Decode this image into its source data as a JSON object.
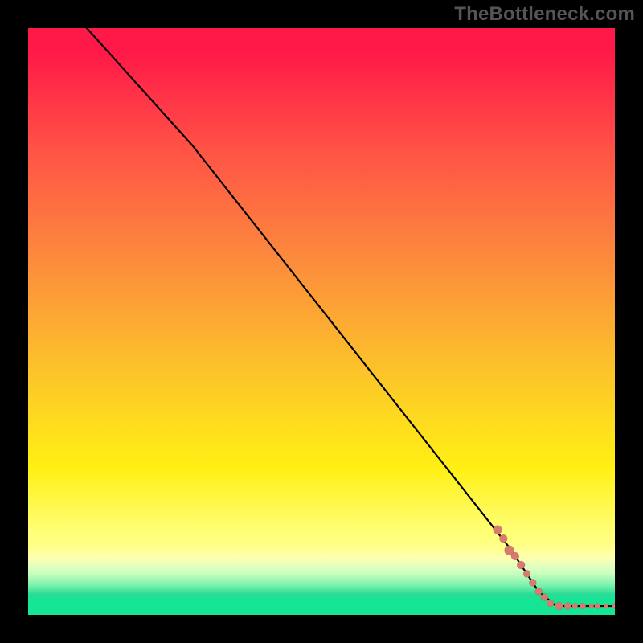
{
  "watermark": "TheBottleneck.com",
  "colors": {
    "frame": "#000000",
    "watermark": "#555555",
    "curve": "#000000",
    "dot": "#d87a6e",
    "gradient_stops": [
      "#ff1948",
      "#ff5046",
      "#fc8c3c",
      "#fcc828",
      "#fff014",
      "#ffff78",
      "#c8ffbe",
      "#28dc96"
    ]
  },
  "chart_data": {
    "type": "line",
    "title": "",
    "xlabel": "",
    "ylabel": "",
    "xlim": [
      0,
      100
    ],
    "ylim": [
      0,
      100
    ],
    "grid": false,
    "legend": false,
    "curve": [
      {
        "x": 10.0,
        "y": 100.0
      },
      {
        "x": 28.0,
        "y": 80.0
      },
      {
        "x": 82.0,
        "y": 11.5
      },
      {
        "x": 87.0,
        "y": 4.0
      },
      {
        "x": 90.0,
        "y": 1.5
      },
      {
        "x": 100.0,
        "y": 1.5
      }
    ],
    "points": [
      {
        "x": 80.0,
        "y": 14.5,
        "r": 5.5
      },
      {
        "x": 81.0,
        "y": 13.0,
        "r": 5.0
      },
      {
        "x": 82.0,
        "y": 11.0,
        "r": 6.0
      },
      {
        "x": 83.0,
        "y": 10.0,
        "r": 5.0
      },
      {
        "x": 84.0,
        "y": 8.5,
        "r": 5.0
      },
      {
        "x": 85.0,
        "y": 7.0,
        "r": 4.5
      },
      {
        "x": 86.0,
        "y": 5.5,
        "r": 4.5
      },
      {
        "x": 87.0,
        "y": 4.0,
        "r": 4.5
      },
      {
        "x": 88.0,
        "y": 3.0,
        "r": 4.5
      },
      {
        "x": 89.0,
        "y": 2.0,
        "r": 4.5
      },
      {
        "x": 90.5,
        "y": 1.5,
        "r": 5.0
      },
      {
        "x": 92.0,
        "y": 1.5,
        "r": 4.5
      },
      {
        "x": 93.2,
        "y": 1.5,
        "r": 3.5
      },
      {
        "x": 94.5,
        "y": 1.5,
        "r": 4.0
      },
      {
        "x": 96.0,
        "y": 1.5,
        "r": 3.0
      },
      {
        "x": 97.0,
        "y": 1.5,
        "r": 3.5
      },
      {
        "x": 98.5,
        "y": 1.5,
        "r": 3.0
      },
      {
        "x": 100.0,
        "y": 1.5,
        "r": 3.5
      }
    ]
  }
}
